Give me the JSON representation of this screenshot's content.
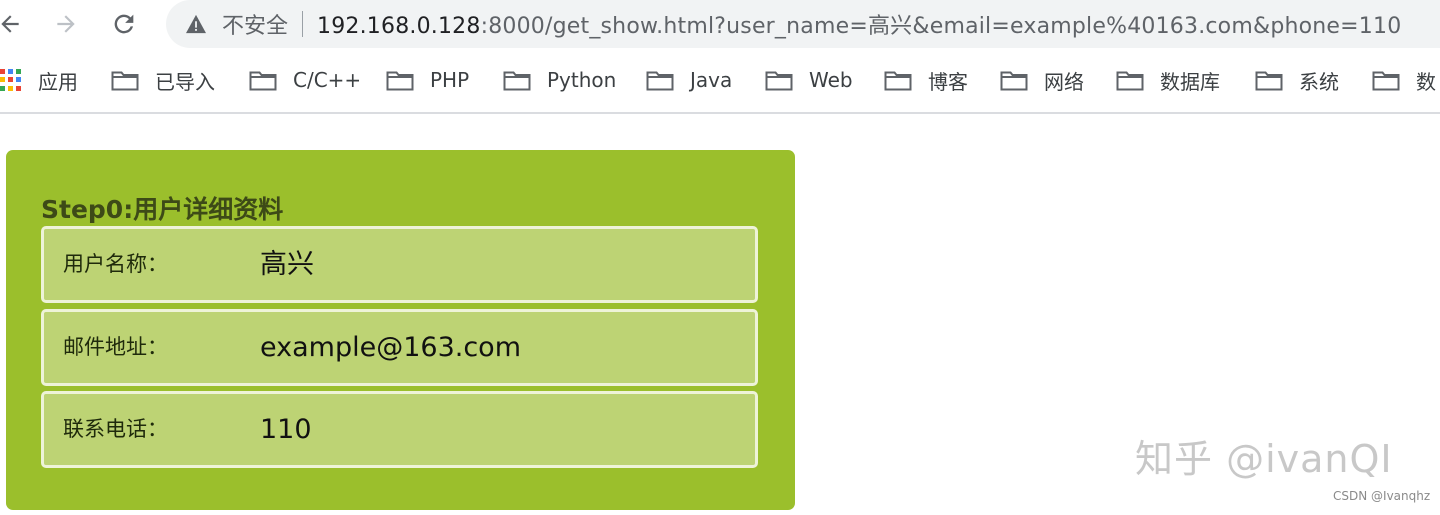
{
  "browser": {
    "insecure_label": "不安全",
    "url_host": "192.168.0.128",
    "url_rest": ":8000/get_show.html?user_name=高兴&email=example%40163.com&phone=110",
    "icons": {
      "back": "arrow-left-icon",
      "forward": "arrow-right-icon",
      "reload": "reload-icon",
      "warning": "warning-triangle-icon"
    }
  },
  "bookmarks": [
    {
      "label": "应用",
      "icon": "apps-grid-icon"
    },
    {
      "label": "已导入",
      "icon": "folder-icon"
    },
    {
      "label": "C/C++",
      "icon": "folder-icon"
    },
    {
      "label": "PHP",
      "icon": "folder-icon"
    },
    {
      "label": "Python",
      "icon": "folder-icon"
    },
    {
      "label": "Java",
      "icon": "folder-icon"
    },
    {
      "label": "Web",
      "icon": "folder-icon"
    },
    {
      "label": "博客",
      "icon": "folder-icon"
    },
    {
      "label": "网络",
      "icon": "folder-icon"
    },
    {
      "label": "数据库",
      "icon": "folder-icon"
    },
    {
      "label": "系统",
      "icon": "folder-icon"
    },
    {
      "label": "数",
      "icon": "folder-icon"
    }
  ],
  "card": {
    "title": "Step0:用户详细资料",
    "rows": [
      {
        "label": "用户名称：",
        "value": "高兴"
      },
      {
        "label": "邮件地址：",
        "value": "example@163.com"
      },
      {
        "label": "联系电话：",
        "value": "110"
      }
    ]
  },
  "watermark": {
    "main": "知乎 @ivanQI",
    "csdn": "CSDN @Ivanqhz"
  },
  "colors": {
    "card_bg": "#9bbf2c",
    "row_bg": "#bdd374",
    "row_border": "#eef3d8",
    "omnibox_bg": "#f1f3f4"
  }
}
